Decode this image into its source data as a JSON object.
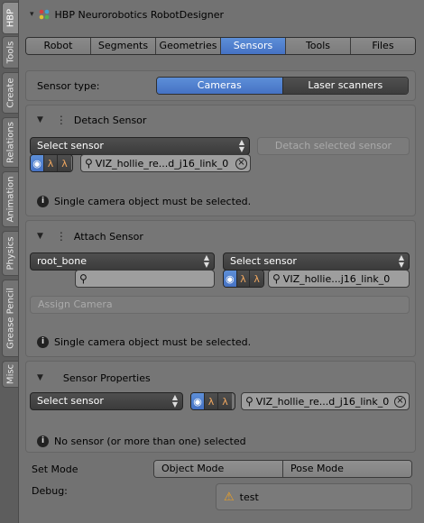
{
  "vtabs": [
    "HBP",
    "Tools",
    "Create",
    "Relations",
    "Animation",
    "Physics",
    "Grease Pencil",
    "Misc"
  ],
  "header": {
    "title": "HBP Neurorobotics RobotDesigner"
  },
  "tabs": [
    "Robot",
    "Segments",
    "Geometries",
    "Sensors",
    "Tools",
    "Files"
  ],
  "active_tab": "Sensors",
  "sensor_type": {
    "label": "Sensor type:",
    "options": [
      "Cameras",
      "Laser scanners"
    ],
    "selected": "Cameras"
  },
  "detach": {
    "title": "Detach Sensor",
    "select_label": "Select sensor",
    "detach_button": "Detach selected sensor",
    "object_value": "VIZ_hollie_re...d_j16_link_0",
    "info": "Single camera object must be selected."
  },
  "attach": {
    "title": "Attach Sensor",
    "bone_select": "root_bone",
    "sensor_select": "Select sensor",
    "object_value": "VIZ_hollie...j16_link_0",
    "assign_button": "Assign Camera",
    "info": "Single camera object must be selected."
  },
  "properties": {
    "title": "Sensor Properties",
    "select_label": "Select sensor",
    "object_value": "VIZ_hollie_re...d_j16_link_0",
    "info": "No sensor (or more than one) selected"
  },
  "set_mode": {
    "label": "Set Mode",
    "options": [
      "Object Mode",
      "Pose Mode"
    ]
  },
  "debug": {
    "label": "Debug:",
    "message": "test"
  },
  "colors": {
    "background": "#727272",
    "accent": "#4f7fd0",
    "warning": "#f0a020"
  }
}
